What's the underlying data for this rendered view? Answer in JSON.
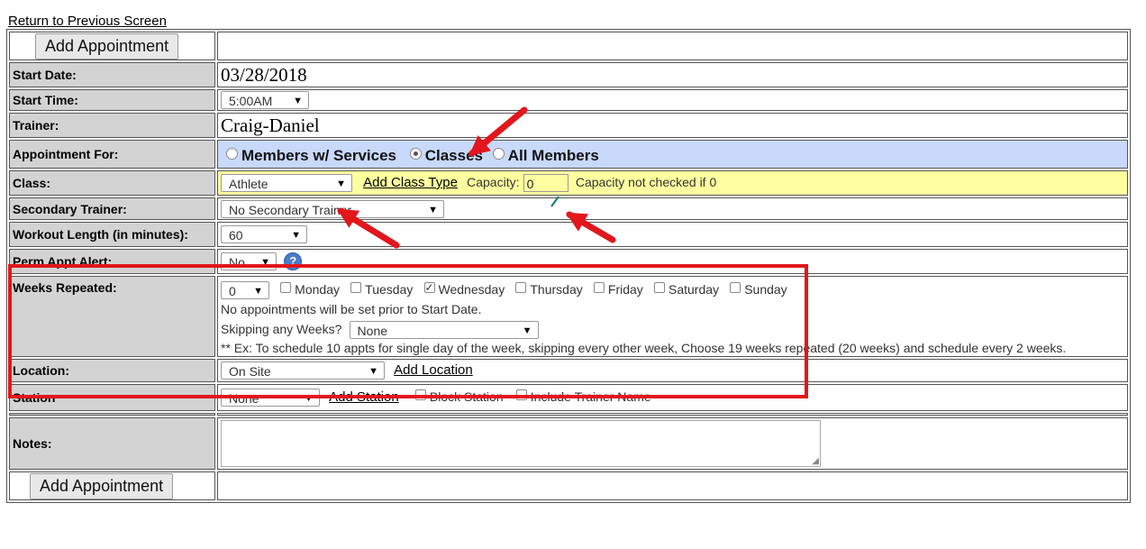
{
  "return_link": "Return to Previous Screen",
  "add_appointment_label": "Add Appointment",
  "labels": {
    "start_date": "Start Date:",
    "start_time": "Start Time:",
    "trainer": "Trainer:",
    "appointment_for": "Appointment For:",
    "class": "Class:",
    "secondary_trainer": "Secondary Trainer:",
    "workout_length": "Workout Length (in minutes):",
    "perm_appt_alert": "Perm Appt Alert:",
    "weeks_repeated": "Weeks Repeated:",
    "location": "Location:",
    "station": "Station",
    "notes": "Notes:"
  },
  "values": {
    "start_date": "03/28/2018",
    "start_time": "5:00AM",
    "trainer": "Craig-Daniel",
    "appointment_for": {
      "options": [
        {
          "label": "Members w/ Services",
          "selected": false
        },
        {
          "label": "Classes",
          "selected": true
        },
        {
          "label": "All Members",
          "selected": false
        }
      ]
    },
    "class": {
      "selected": "Athlete",
      "add_link": "Add Class Type",
      "capacity_label": "Capacity:",
      "capacity_value": "0",
      "capacity_note": "Capacity not checked if 0"
    },
    "secondary_trainer": "No Secondary Trainer",
    "workout_length": "60",
    "perm_appt_alert": "No",
    "weeks_repeated": {
      "value": "0",
      "days": [
        {
          "label": "Monday",
          "checked": false
        },
        {
          "label": "Tuesday",
          "checked": false
        },
        {
          "label": "Wednesday",
          "checked": true
        },
        {
          "label": "Thursday",
          "checked": false
        },
        {
          "label": "Friday",
          "checked": false
        },
        {
          "label": "Saturday",
          "checked": false
        },
        {
          "label": "Sunday",
          "checked": false
        }
      ],
      "note": "No appointments will be set prior to Start Date.",
      "skipping_label": "Skipping any Weeks?",
      "skipping_value": "None",
      "example": "** Ex: To schedule 10 appts for single day of the week, skipping every other week, Choose 19 weeks repeated (20 weeks) and schedule every 2 weeks."
    },
    "location": {
      "selected": "On Site",
      "add_link": "Add Location"
    },
    "station": {
      "selected": "None",
      "add_link": "Add Station",
      "block_station": "Block Station",
      "include_trainer": "Include Trainer Name"
    }
  },
  "colors": {
    "label_bg": "#d3d3d3",
    "appointment_for_bg": "#c8d9fb",
    "class_row_bg": "#ffffa0",
    "annotation_red": "#e2161c"
  }
}
